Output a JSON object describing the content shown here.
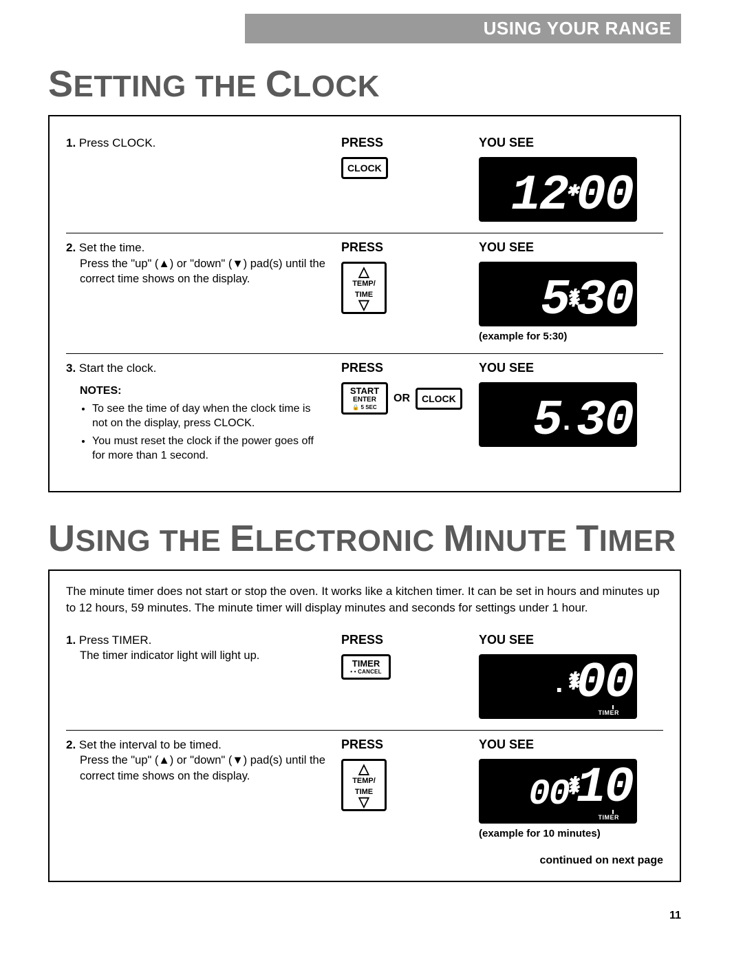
{
  "header": "USING YOUR RANGE",
  "section1_title_cap": "S",
  "section1_title_rest": "ETTING THE ",
  "section1_title_cap2": "C",
  "section1_title_rest2": "LOCK",
  "s1": {
    "step1_n": "1.",
    "step1": "Press CLOCK.",
    "press": "PRESS",
    "yousee": "YOU SEE",
    "btn_clock": "CLOCK",
    "disp1": [
      "1",
      "2",
      "✱",
      "0",
      "0"
    ],
    "step2_n": "2.",
    "step2": "Set the time.",
    "step2_sub": "Press the \"up\" (▲) or \"down\" (▼) pad(s) until the correct time shows on the display.",
    "btn_temp_l1": "TEMP/",
    "btn_temp_l2": "TIME",
    "disp2": [
      "5",
      "✱✱",
      "3",
      "0"
    ],
    "disp2_caption": "(example for 5:30)",
    "step3_n": "3.",
    "step3": "Start the clock.",
    "notes_label": "NOTES:",
    "note1": "To see the time of day when the clock time is not on the display, press CLOCK.",
    "note2": "You must reset the clock if the power goes off for more than 1 second.",
    "btn_start_l1": "START",
    "btn_start_l2": "ENTER",
    "btn_start_l3": "5 SEC",
    "or": "OR",
    "disp3": [
      "5",
      ".",
      "3",
      "0"
    ]
  },
  "section2_title_cap": "U",
  "section2_title_rest": "SING THE ",
  "section2_title_cap2": "E",
  "section2_title_rest2": "LECTRONIC ",
  "section2_title_cap3": "M",
  "section2_title_rest3": "INUTE ",
  "section2_title_cap4": "T",
  "section2_title_rest4": "IMER",
  "s2": {
    "intro": "The minute timer does not start or stop the oven. It works like a kitchen timer. It can be set in hours and minutes up to 12 hours, 59 minutes. The minute timer will display minutes and seconds for settings under 1 hour.",
    "step1_n": "1.",
    "step1": "Press TIMER.",
    "step1_sub": "The timer indicator light will light up.",
    "btn_timer_l1": "TIMER",
    "btn_timer_l2": "• • CANCEL",
    "disp1": [
      ".",
      "✱✱",
      "0",
      "0"
    ],
    "timer_lbl": "TIMER",
    "step2_n": "2.",
    "step2": "Set the interval to be timed.",
    "step2_sub": "Press the \"up\" (▲) or \"down\" (▼) pad(s) until the correct time shows on the display.",
    "disp2": [
      "0",
      "0",
      "✱✱",
      "1",
      "0"
    ],
    "disp2_caption": "(example for 10 minutes)"
  },
  "continued": "continued on next page",
  "pagenum": "11"
}
